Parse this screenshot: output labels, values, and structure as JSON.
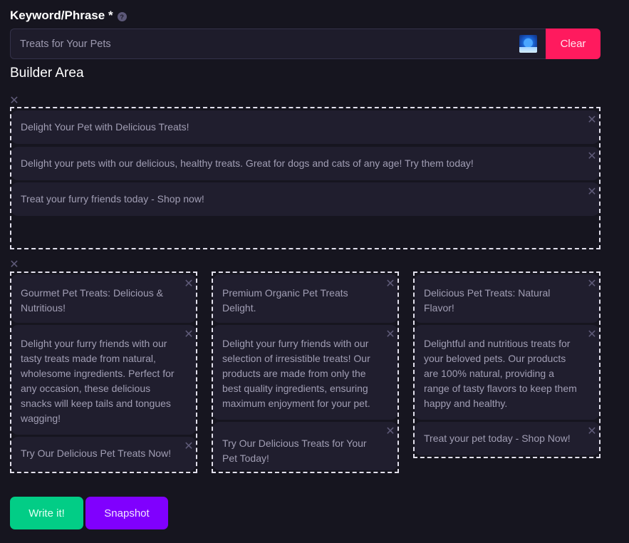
{
  "keyword": {
    "label": "Keyword/Phrase *",
    "help_icon": "question-mark-icon",
    "help_glyph": "?",
    "value": "Treats for Your Pets",
    "extension_icon": "blue-orb-extension-icon",
    "clear_label": "Clear"
  },
  "builder": {
    "title": "Builder Area",
    "close_glyph": "✕",
    "groups": [
      {
        "cards": [
          "Delight Your Pet with Delicious Treats!",
          "Delight your pets with our delicious, healthy treats. Great for dogs and cats of any age! Try them today!",
          "Treat your furry friends today - Shop now!"
        ]
      },
      {
        "cards": [
          "Gourmet Pet Treats: Delicious & Nutritious!",
          "Delight your furry friends with our tasty treats made from natural, wholesome ingredients. Perfect for any occasion, these delicious snacks will keep tails and tongues wagging!",
          "Try Our Delicious Pet Treats Now!"
        ]
      },
      {
        "cards": [
          "Premium Organic Pet Treats Delight.",
          "Delight your furry friends with our selection of irresistible treats! Our products are made from only the best quality ingredients, ensuring maximum enjoyment for your pet.",
          "Try Our Delicious Treats for Your Pet Today!"
        ]
      },
      {
        "cards": [
          "Delicious Pet Treats: Natural Flavor!",
          "Delightful and nutritious treats for your beloved pets. Our products are 100% natural, providing a range of tasty flavors to keep them happy and healthy.",
          "Treat your pet today - Shop Now!"
        ]
      }
    ]
  },
  "actions": {
    "write_label": "Write it!",
    "snapshot_label": "Snapshot"
  },
  "colors": {
    "background": "#16151f",
    "card": "#201e2e",
    "clear": "#ff1a5e",
    "write": "#02cd86",
    "snapshot": "#8000fe"
  }
}
